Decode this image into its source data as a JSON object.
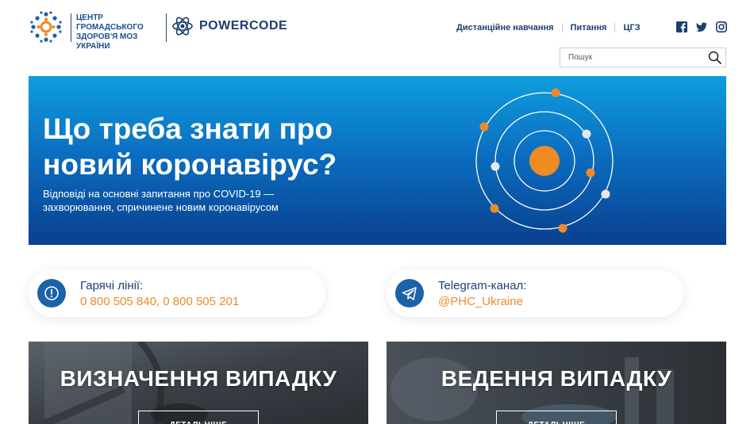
{
  "header": {
    "org_name_line1": "ЦЕНТР ГРОМАДСЬКОГО",
    "org_name_line2": "ЗДОРОВ'Я МОЗ УКРАЇНИ",
    "partner_name": "POWERCODE",
    "nav": [
      {
        "label": "Дистанційне навчання"
      },
      {
        "label": "Питання"
      },
      {
        "label": "ЦГЗ"
      }
    ],
    "social_icons": [
      "facebook-icon",
      "twitter-icon",
      "instagram-icon"
    ],
    "search": {
      "placeholder": "Пошук",
      "value": ""
    }
  },
  "hero": {
    "title": "Що треба знати про новий коронавірус?",
    "subtitle": "Відповіді на основні запитання про COVID-19 — захворювання, спричинене новим коронавірусом"
  },
  "contacts": [
    {
      "title": "Гарячі лінії:",
      "value": "0 800 505 840, 0 800 505 201",
      "icon": "info-icon"
    },
    {
      "title": "Telegram-канал:",
      "value": "@PHC_Ukraine",
      "icon": "telegram-icon"
    }
  ],
  "tiles": [
    {
      "title": "ВИЗНАЧЕННЯ ВИПАДКУ",
      "button": "ДЕТАЛЬНІШЕ"
    },
    {
      "title": "ВЕДЕННЯ ВИПАДКУ",
      "button": "ДЕТАЛЬНІШЕ"
    }
  ],
  "colors": {
    "brand_blue": "#1b3f6e",
    "accent_orange": "#f08a24",
    "hero_top": "#0e9ede",
    "hero_bottom": "#0a3f8e"
  }
}
